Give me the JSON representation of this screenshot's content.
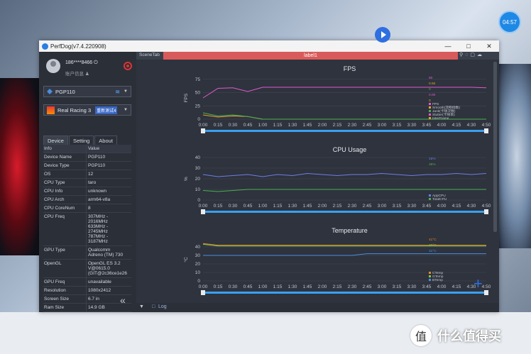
{
  "clock": "04:57",
  "watermark": {
    "logo_glyph": "值",
    "text": "什么值得买"
  },
  "window": {
    "title": "PerfDog(v7.4.220908)"
  },
  "user": {
    "name": "186****8466",
    "info": "账户信息"
  },
  "device_select": {
    "value": "PGP110"
  },
  "app_select": {
    "value": "Real Racing 3",
    "tag": "重新测试4"
  },
  "tabs": [
    "Device",
    "Setting",
    "About"
  ],
  "device_info": {
    "header": {
      "k": "Info",
      "v": "Value"
    },
    "rows": [
      {
        "k": "Device Name",
        "v": "PGP110"
      },
      {
        "k": "Device Type",
        "v": "PGP110"
      },
      {
        "k": "OS",
        "v": "12"
      },
      {
        "k": "CPU Type",
        "v": "taro"
      },
      {
        "k": "CPU Info",
        "v": "unknown"
      },
      {
        "k": "CPU Arch",
        "v": "arm64-v8a"
      },
      {
        "k": "CPU CoreNum",
        "v": "8"
      },
      {
        "k": "CPU Freq",
        "v": "307MHz -\n2016MHz\n633MHz -\n2745MHz\n787MHz -\n3187MHz"
      },
      {
        "k": "GPU Type",
        "v": "Qualcomm\nAdreno (TM) 730"
      },
      {
        "k": "OpenGL",
        "v": "OpenGL ES 3.2\nV@0615.0\n(GIT@2c36ce1e26"
      },
      {
        "k": "GPU Freq",
        "v": "unavailable"
      },
      {
        "k": "Resolution",
        "v": "1080x2412"
      },
      {
        "k": "Screen Size",
        "v": "6.7 in"
      },
      {
        "k": "Ram Size",
        "v": "14.9 GB"
      }
    ]
  },
  "scene_tab": "SceneTab",
  "label_bar": "label1",
  "log_label": "Log",
  "colors": {
    "accent": "#2f6fe0",
    "fps": "#e05ad0",
    "cpu_app": "#4caf50",
    "cpu_total": "#6f7de8",
    "ctemp": "#e0892a",
    "gtemp": "#8bc34a",
    "btemp": "#4a8fe0"
  },
  "x_ticks": [
    "0:00",
    "0:15",
    "0:30",
    "0:45",
    "1:00",
    "1:15",
    "1:30",
    "1:45",
    "2:00",
    "2:15",
    "2:30",
    "2:45",
    "3:00",
    "3:15",
    "3:30",
    "3:45",
    "4:00",
    "4:15",
    "4:30",
    "4:50"
  ],
  "chart_data": [
    {
      "type": "line",
      "title": "FPS",
      "ylabel": "FPS",
      "yticks": [
        "0",
        "25",
        "50",
        "75"
      ],
      "ylim": [
        0,
        80
      ],
      "x": [
        "0:00",
        "0:15",
        "0:30",
        "0:45",
        "1:00",
        "1:15",
        "1:30",
        "1:45",
        "2:00",
        "2:15",
        "2:30",
        "2:45",
        "3:00",
        "3:15",
        "3:30",
        "3:45",
        "4:00",
        "4:15",
        "4:30",
        "4:50"
      ],
      "series": [
        {
          "name": "FPS",
          "color": "#e05ad0",
          "values": [
            40,
            58,
            59,
            52,
            60,
            60,
            60,
            60,
            60,
            60,
            60,
            60,
            60,
            60,
            60,
            60,
            60,
            60,
            60,
            59
          ]
        },
        {
          "name": "Jank(卡顿次数)",
          "color": "#e8a030",
          "values": [
            8,
            4,
            6,
            5,
            0,
            0,
            0,
            0,
            0,
            0,
            0,
            0,
            0,
            0,
            0,
            0,
            0,
            0,
            0,
            0
          ]
        },
        {
          "name": "Stutter(卡顿率)",
          "color": "#4caf50",
          "values": [
            12,
            6,
            8,
            5,
            0,
            0,
            0,
            0,
            0,
            0,
            0,
            0,
            0,
            0,
            0,
            0,
            0,
            0,
            0,
            0
          ]
        }
      ],
      "legend": [
        "FPS",
        "Smooth(流畅指数)",
        "Jank(卡顿次数)",
        "Stutter(卡顿率)",
        "InterFrame"
      ],
      "legend_values": [
        "60",
        "0.50",
        "0",
        "0.00",
        "0"
      ]
    },
    {
      "type": "line",
      "title": "CPU Usage",
      "ylabel": "%",
      "yticks": [
        "0",
        "10",
        "20",
        "30",
        "40"
      ],
      "ylim": [
        0,
        40
      ],
      "x": [
        "0:00",
        "0:15",
        "0:30",
        "0:45",
        "1:00",
        "1:15",
        "1:30",
        "1:45",
        "2:00",
        "2:15",
        "2:30",
        "2:45",
        "3:00",
        "3:15",
        "3:30",
        "3:45",
        "4:00",
        "4:15",
        "4:30",
        "4:50"
      ],
      "series": [
        {
          "name": "TotalCPU",
          "color": "#6f7de8",
          "values": [
            24,
            22,
            23,
            24,
            22,
            24,
            23,
            25,
            24,
            23,
            24,
            24,
            25,
            24,
            23,
            24,
            24,
            25,
            24,
            25
          ]
        },
        {
          "name": "AppCPU",
          "color": "#4caf50",
          "values": [
            9,
            8,
            9,
            10,
            10,
            10,
            10,
            10,
            10,
            10,
            10,
            10,
            10,
            10,
            10,
            10,
            10,
            10,
            10,
            10
          ]
        }
      ],
      "legend": [
        "AppCPU",
        "TotalCPU"
      ],
      "legend_values": [
        "15%",
        "35%"
      ]
    },
    {
      "type": "line",
      "title": "Temperature",
      "ylabel": "°C",
      "yticks": [
        "0",
        "10",
        "20",
        "30",
        "40"
      ],
      "ylim": [
        0,
        50
      ],
      "x": [
        "0:00",
        "0:15",
        "0:30",
        "0:45",
        "1:00",
        "1:15",
        "1:30",
        "1:45",
        "2:00",
        "2:15",
        "2:30",
        "2:45",
        "3:00",
        "3:15",
        "3:30",
        "3:45",
        "4:00",
        "4:15",
        "4:30",
        "4:50"
      ],
      "series": [
        {
          "name": "CTemp",
          "color": "#e0892a",
          "values": [
            44,
            42,
            42,
            42,
            42,
            42,
            42,
            42,
            42,
            42,
            42,
            42,
            42,
            42,
            42,
            42,
            42,
            42,
            42,
            42
          ]
        },
        {
          "name": "GTemp",
          "color": "#8bc34a",
          "values": [
            43,
            41,
            41,
            41,
            41,
            41,
            41,
            41,
            41,
            41,
            41,
            41,
            41,
            41,
            41,
            41,
            41,
            41,
            41,
            41
          ]
        },
        {
          "name": "BTemp",
          "color": "#4a8fe0",
          "values": [
            30,
            30,
            30,
            30,
            30,
            30,
            30,
            30,
            30,
            30,
            30,
            32,
            32,
            32,
            32,
            32,
            32,
            32,
            32,
            32
          ]
        }
      ],
      "legend": [
        "CTemp",
        "GTemp",
        "BTemp"
      ],
      "legend_values": [
        "41°C",
        "40°C",
        "31°C"
      ]
    }
  ]
}
